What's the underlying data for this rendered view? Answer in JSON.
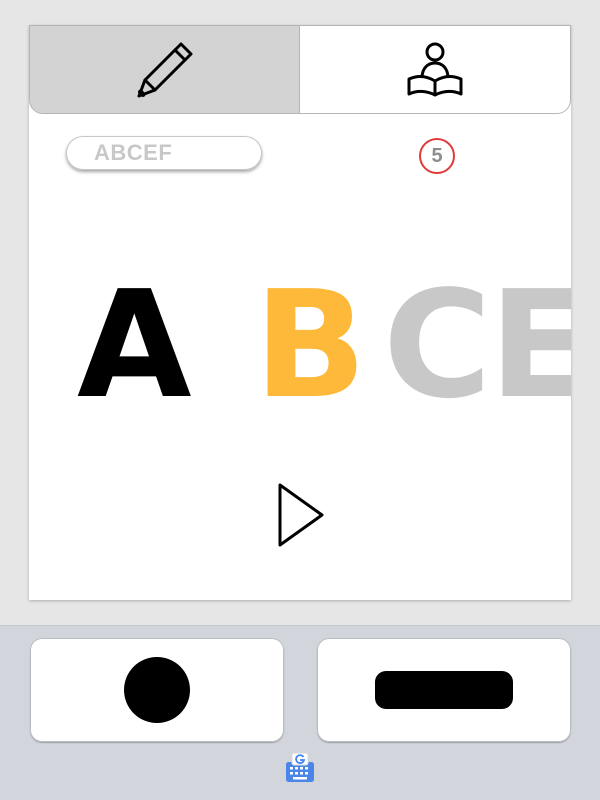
{
  "tabs": [
    {
      "name": "write",
      "icon": "pencil-icon",
      "selected": true
    },
    {
      "name": "learn",
      "icon": "reading-person-icon",
      "selected": false
    }
  ],
  "word": "ABCEF",
  "count": "5",
  "letters": [
    {
      "char": "A",
      "color": "#000000"
    },
    {
      "char": "B",
      "color": "#ffb93a"
    },
    {
      "char": "C",
      "color": "#c8c8c8"
    },
    {
      "char": "E",
      "color": "#c8c8c8"
    }
  ],
  "play_icon": "play-icon",
  "keyboard": {
    "keys": [
      {
        "name": "dot",
        "icon": "dot-icon"
      },
      {
        "name": "dash",
        "icon": "dash-icon"
      }
    ],
    "switcher_icon": "gboard-keyboard-icon"
  },
  "colors": {
    "tab_selected_bg": "#d3d3d3",
    "accent": "#ffb93a",
    "badge_ring": "#e03a3a",
    "keyboard_bg": "#d2d5dc"
  }
}
